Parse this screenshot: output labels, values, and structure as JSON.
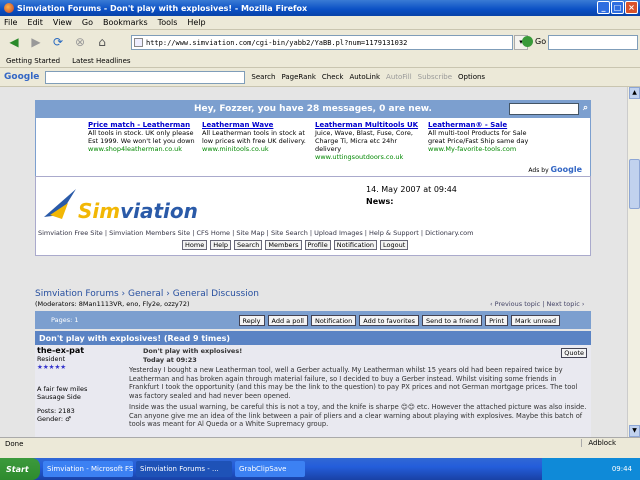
{
  "window": {
    "title": "Simviation Forums - Don't play with explosives! - Mozilla Firefox"
  },
  "menu": [
    "File",
    "Edit",
    "View",
    "Go",
    "Bookmarks",
    "Tools",
    "Help"
  ],
  "nav": {
    "url": "http://www.simviation.com/cgi-bin/yabb2/YaBB.pl?num=1179131032",
    "go_label": "Go"
  },
  "bookmarks": [
    "Getting Started",
    "Latest Headlines"
  ],
  "google_toolbar": {
    "logo": "Google",
    "items": [
      "Search",
      "PageRank",
      "Check",
      "AutoLink",
      "AutoFill",
      "Subscribe",
      "Options"
    ]
  },
  "forum": {
    "welcome": "Hey, Fozzer, you have 28 messages, 0 are new.",
    "ads": [
      {
        "title": "Price match - Leatherman",
        "text": "All tools in stock. UK only please Est 1999. We won't let you down",
        "url": "www.shop4leatherman.co.uk"
      },
      {
        "title": "Leatherman Wave",
        "text": "All Leatherman tools in stock at low prices with free UK delivery.",
        "url": "www.minitools.co.uk"
      },
      {
        "title": "Leatherman Multitools UK",
        "text": "Juice, Wave, Blast, Fuse, Core, Charge Ti, Micra etc 24hr delivery",
        "url": "www.uttingsoutdoors.co.uk"
      },
      {
        "title": "Leatherman® - Sale",
        "text": "All multi-tool Products for Sale great Price/Fast Ship same day",
        "url": "www.My-favorite-tools.com"
      }
    ],
    "ads_by": "Ads by",
    "ads_by_brand": "Google",
    "logo": {
      "part1": "Sim",
      "part2": "viation"
    },
    "date": "14. May 2007 at 09:44",
    "news_label": "News:",
    "site_nav": "Simviation Free Site | Simviation Members Site | CFS Home | Site Map | Site Search | Upload Images | Help & Support | Dictionary.com",
    "member_buttons": [
      "Home",
      "Help",
      "Search",
      "Members",
      "Profile",
      "Notification",
      "Logout"
    ],
    "breadcrumb": "Simviation Forums › General › General Discussion",
    "moderators": "(Moderators: 8Man1113VR, eno, Fly2e, ozzy72)",
    "topic_nav": "‹ Previous topic | Next topic ›",
    "pages_label": "Pages: 1",
    "thread_buttons": [
      "Reply",
      "Add a poll",
      "Notification",
      "Add to favorites",
      "Send to a friend",
      "Print",
      "Mark unread"
    ],
    "topic_title": "Don't play with explosives! (Read 9 times)",
    "post": {
      "author": "the-ex-pat",
      "rank": "Resident",
      "stars": "★★★★★",
      "info": "A fair few miles",
      "location": "Sausage Side",
      "posts": "Posts: 2183",
      "gender": "Gender: ♂",
      "title": "Don't play with explosives!",
      "time": "Today at 09:23",
      "quote": "Quote",
      "p1": "Yesterday I bought a new Leatherman tool, well a Gerber actually. My Leatherman whilst 15 years old had been repaired twice by Leatherman and has broken again through material failure, so I decided to buy a Gerber instead. Whilst visiting some friends in Frankfurt I took the opportunity (and this may be the link to the question) to pay PX prices and not German mortgage prices. The tool was factory sealed and had never been opened.",
      "p2": "Inside was the usual warning, be careful this is not a toy, and the knife is sharpe 😊😊 etc. However the attached picture was also inside. Can anyone give me an idea of the link between a pair of pliers and a clear warning about playing with explosives. Maybe this batch of tools was meant for Al Queda or a White Supremacy group."
    }
  },
  "status": {
    "text": "Done",
    "adblock": "Adblock"
  },
  "taskbar": {
    "start": "Start",
    "tasks": [
      "Simviation - Microsoft FSX...",
      "Simviation Forums - ...",
      "GrabClipSave"
    ],
    "time": "09:44"
  }
}
